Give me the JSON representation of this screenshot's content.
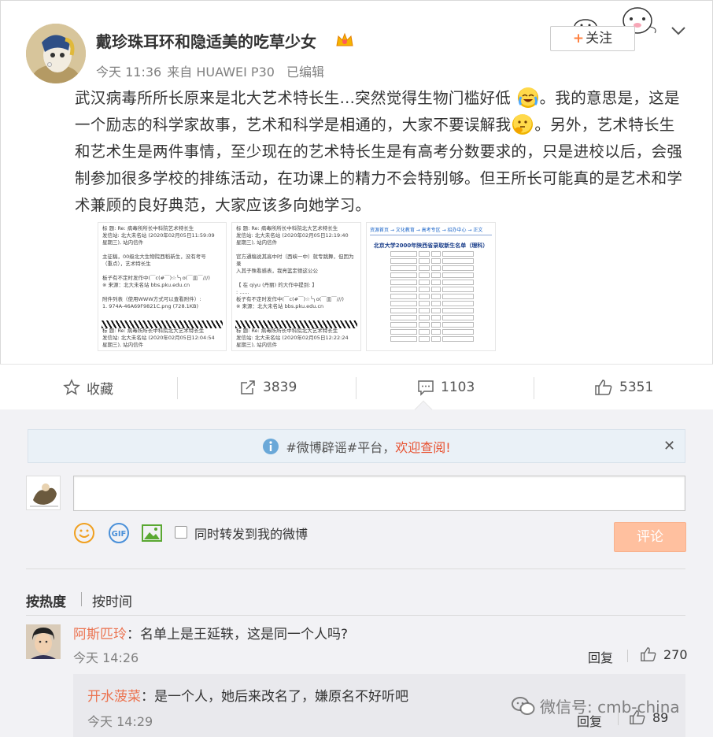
{
  "post": {
    "username": "戴珍珠耳环和隐适美的吃草少女",
    "time": "今天 11:36",
    "source": "来自 HUAWEI P30",
    "edited": "已编辑",
    "follow_label": "关注",
    "text_part1": "武汉病毒所所长原来是北大艺术特长生...突然觉得生物门槛好低",
    "text_part2": "。我的意思是，这是一个励志的科学家故事，艺术和科学是相通的，大家不要误解我",
    "text_part3": "。另外，艺术特长生和艺术生是两件事情，至少现在的艺术特长生是有高考分数要求的，只是进校以后，会强制参加很多学校的排练活动，在功课上的精力不会特别够。但王所长可能真的是艺术和学术兼顾的良好典范，大家应该多向她学习。",
    "emoji_1": "cry-laugh-emoji",
    "emoji_2": "thinking-emoji"
  },
  "thumbnails": {
    "img1": {
      "line1": "标  题: Re: 病毒所所长中科院艺术特长生",
      "line2": "发信站: 北大未名站 (2020年02月05日11:59:09",
      "line3": "星期三), 站内信件",
      "line4": "主征稿，00级北大生物院西稻新生，没有考号",
      "line5": "（重点），艺术特长生",
      "line6": "板子有不定时发作中(￣c(#￣)☆╰╮o(￣皿￣///)",
      "line7": "※ 来源：北大未名站 bbs.pku.edu.cn",
      "line8": "附件列表（使用WWW方式可以查看附件）:",
      "line9": "1. 974A-46A69F9821C.png (728.1KB)",
      "line10": "标  题: Re: 病毒所所长中科院北大艺术特长生",
      "line11": "发信站: 北大未名站 (2020年02月05日12:04:54",
      "line12": "星期三), 站内信件"
    },
    "img2": {
      "line1": "标  题: Re: 病毒所所长中科院北大艺术特长生",
      "line2": "发信站: 北大未名站 (2020年02月05日12:19:40",
      "line3": "星期三), 站内信件",
      "line4": "官方通稿说其高中时（西峡一中）就专跳舞，但因为录",
      "line5": "入其子殊看感表，我亮篮定德这公公",
      "line6": "【 在 qiyu (丹丽) 的大作中提到: 】",
      "line7": ": ......",
      "line8": "板子有不定时发作中(￣c(#￣)☆╰╮o(￣皿￣///)",
      "line9": "※ 来源：北大未名站 bbs.pku.edu.cn",
      "line10": "标  题: Re: 病毒所所长中科院北大艺术特长生",
      "line11": "发信站: 北大未名站 (2020年02月05日12:22:24",
      "line12": "星期三), 站内信件"
    },
    "img3": {
      "header": "资源首页 → 文化教育 → 高考专区 → 招办中心 → 正文",
      "title": "北京大学2000年陕西省录取新生名单（理科）"
    }
  },
  "actions": {
    "favorite_label": "收藏",
    "repost_count": "3839",
    "comment_count": "1103",
    "like_count": "5351"
  },
  "comments_panel": {
    "rumor_text": "#微博辟谣#平台，",
    "rumor_link": "欢迎查阅!",
    "repost_also": "同时转发到我的微博",
    "submit_label": "评论",
    "sort_hot": "按热度",
    "sort_time": "按时间",
    "comment1": {
      "user": "阿斯匹玲",
      "text": "：名单上是王延轶，这是同一个人吗?",
      "time": "今天 14:26",
      "reply": "回复",
      "likes": "270"
    },
    "subcomment1": {
      "user": "开水菠菜",
      "text": "：是一个人，她后来改名了，嫌原名不好听吧",
      "time": "今天 14:29",
      "reply": "回复",
      "likes": "89"
    }
  },
  "watermark": "微信号: cmb-china",
  "colors": {
    "accent_orange": "#eb7350",
    "link_red": "#e8502f",
    "submit_disabled": "#ffc09f"
  }
}
